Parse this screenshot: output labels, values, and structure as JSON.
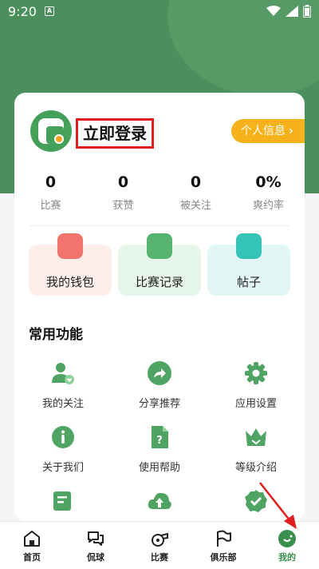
{
  "status": {
    "time": "9:20",
    "notif": "A"
  },
  "profile": {
    "login_label": "立即登录",
    "info_button": "个人信息",
    "info_arrow": "›"
  },
  "stats": [
    {
      "value": "0",
      "label": "比赛"
    },
    {
      "value": "0",
      "label": "获赞"
    },
    {
      "value": "0",
      "label": "被关注"
    },
    {
      "value": "0%",
      "label": "爽约率"
    }
  ],
  "quick": {
    "wallet": "我的钱包",
    "record": "比赛记录",
    "post": "帖子"
  },
  "functions": {
    "title": "常用功能",
    "items": [
      {
        "label": "我的关注",
        "icon": "user-heart-icon"
      },
      {
        "label": "分享推荐",
        "icon": "share-icon"
      },
      {
        "label": "应用设置",
        "icon": "gear-icon"
      },
      {
        "label": "关于我们",
        "icon": "info-icon"
      },
      {
        "label": "使用帮助",
        "icon": "help-doc-icon"
      },
      {
        "label": "等级介绍",
        "icon": "crown-icon"
      }
    ]
  },
  "nav": [
    {
      "label": "首页",
      "icon": "home-icon"
    },
    {
      "label": "侃球",
      "icon": "chat-icon"
    },
    {
      "label": "比赛",
      "icon": "whistle-icon"
    },
    {
      "label": "俱乐部",
      "icon": "flag-icon"
    },
    {
      "label": "我的",
      "icon": "me-icon"
    }
  ],
  "colors": {
    "brand_green": "#4a8f5c",
    "accent_orange": "#f6b21a",
    "highlight_red": "#e11d1d"
  }
}
